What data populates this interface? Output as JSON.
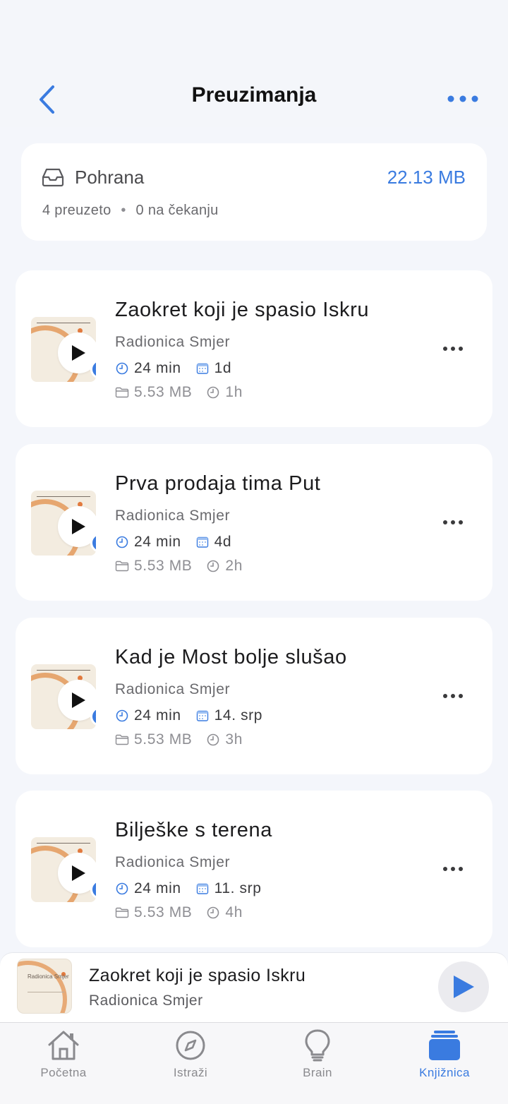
{
  "header": {
    "title": "Preuzimanja",
    "back_icon": "chevron-left-icon",
    "more_icon": "ellipsis-icon"
  },
  "storage": {
    "label": "Pohrana",
    "size": "22.13 MB",
    "downloaded": "4 preuzeto",
    "separator": "•",
    "pending": "0 na čekanju"
  },
  "episodes": [
    {
      "title": "Zaokret koji je spasio Iskru",
      "author": "Radionica Smjer",
      "duration": "24 min",
      "date": "1d",
      "file_size": "5.53 MB",
      "age": "1h"
    },
    {
      "title": "Prva prodaja tima Put",
      "author": "Radionica Smjer",
      "duration": "24 min",
      "date": "4d",
      "file_size": "5.53 MB",
      "age": "2h"
    },
    {
      "title": "Kad je Most bolje slušao",
      "author": "Radionica Smjer",
      "duration": "24 min",
      "date": "14. srp",
      "file_size": "5.53 MB",
      "age": "3h"
    },
    {
      "title": "Bilješke s terena",
      "author": "Radionica Smjer",
      "duration": "24 min",
      "date": "11. srp",
      "file_size": "5.53 MB",
      "age": "4h"
    }
  ],
  "mini_player": {
    "title": "Zaokret koji je spasio Iskru",
    "author": "Radionica Smjer",
    "thumb_text": "Radionica Smjer"
  },
  "tabs": [
    {
      "label": "Početna",
      "icon": "home-icon",
      "active": false
    },
    {
      "label": "Istraži",
      "icon": "compass-icon",
      "active": false
    },
    {
      "label": "Brain",
      "icon": "lightbulb-icon",
      "active": false
    },
    {
      "label": "Knjižnica",
      "icon": "library-icon",
      "active": true
    }
  ],
  "colors": {
    "accent": "#3a7be0",
    "background": "#f4f6fb",
    "card": "#ffffff",
    "thumb_accent": "#e39a5b"
  }
}
